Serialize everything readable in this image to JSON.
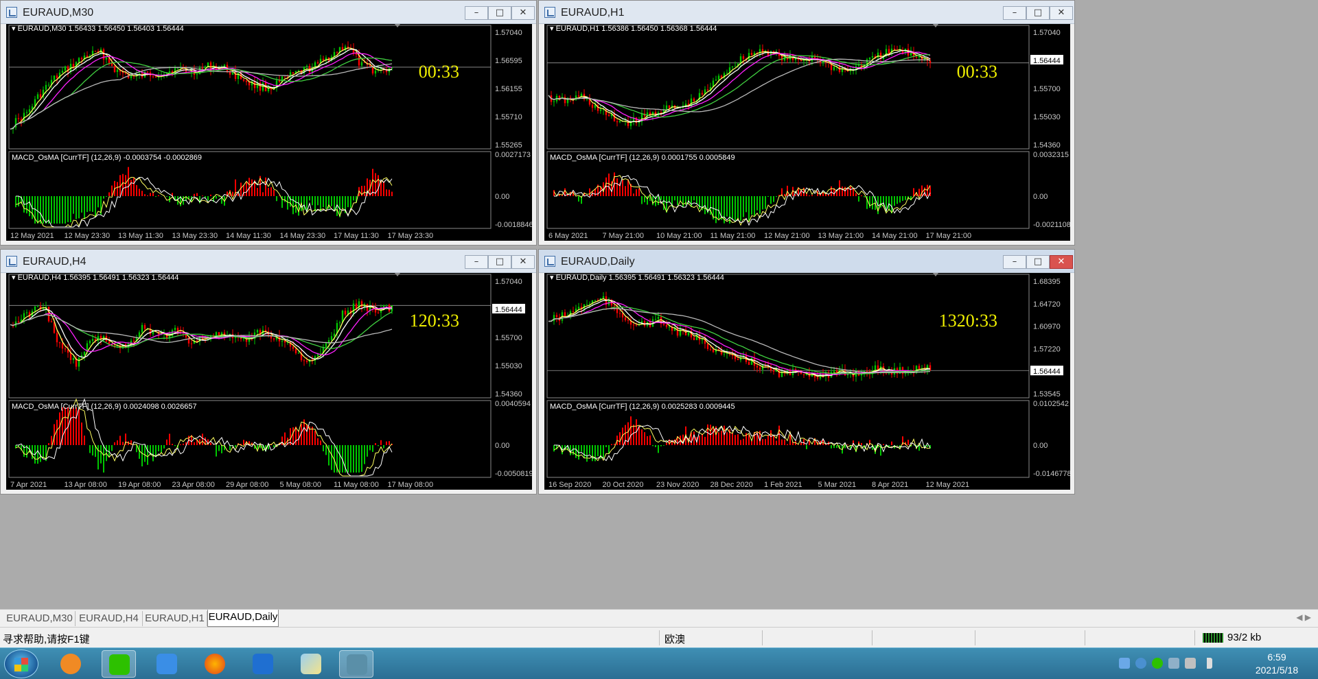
{
  "colors": {
    "bg": "#000000",
    "up": "#00c800",
    "down": "#ff0000",
    "ma_yellow": "#ffff60",
    "ma_white": "#ffffff",
    "ma_magenta": "#ff20ff",
    "ma_green": "#40d040",
    "ma_gray": "#b8b8b8",
    "timer": "#f0f000",
    "grid_text": "#c8c8c8"
  },
  "windows": [
    {
      "title": "EURAUD,M30",
      "info": "EURAUD,M30  1.56433 1.56450 1.56403 1.56444",
      "timer": "00:33",
      "price_levels": [
        "1.57040",
        "1.56595",
        "1.56155",
        "1.55710",
        "1.55265"
      ],
      "current_price": "1.56444",
      "macd_info": "MACD_OsMA [CurrTF] (12,26,9) -0.0003754 -0.0002869",
      "macd_levels": [
        "0.0027173",
        "0.00",
        "-0.0018846"
      ],
      "time_labels": [
        "12 May 2021",
        "12 May 23:30",
        "13 May 11:30",
        "13 May 23:30",
        "14 May 11:30",
        "14 May 23:30",
        "17 May 11:30",
        "17 May 23:30"
      ]
    },
    {
      "title": "EURAUD,H1",
      "info": "EURAUD,H1  1.56386 1.56450 1.56368 1.56444",
      "timer": "00:33",
      "price_levels": [
        "1.57040",
        "1.56444",
        "1.55700",
        "1.55030",
        "1.54360"
      ],
      "current_price": "1.56444",
      "macd_info": "MACD_OsMA [CurrTF] (12,26,9) 0.0001755 0.0005849",
      "macd_levels": [
        "0.0032315",
        "0.00",
        "-0.0021108"
      ],
      "time_labels": [
        "6 May 2021",
        "7 May 21:00",
        "10 May 21:00",
        "11 May 21:00",
        "12 May 21:00",
        "13 May 21:00",
        "14 May 21:00",
        "17 May 21:00"
      ]
    },
    {
      "title": "EURAUD,H4",
      "info": "EURAUD,H4  1.56395 1.56491 1.56323 1.56444",
      "timer": "120:33",
      "price_levels": [
        "1.57040",
        "1.56444",
        "1.55700",
        "1.55030",
        "1.54360"
      ],
      "current_price": "1.56444",
      "macd_info": "MACD_OsMA [CurrTF] (12,26,9) 0.0024098 0.0026657",
      "macd_levels": [
        "0.0040594",
        "0.00",
        "-0.0050819"
      ],
      "time_labels": [
        "7 Apr 2021",
        "13 Apr 08:00",
        "19 Apr 08:00",
        "23 Apr 08:00",
        "29 Apr 08:00",
        "5 May 08:00",
        "11 May 08:00",
        "17 May 08:00"
      ]
    },
    {
      "title": "EURAUD,Daily",
      "info": "EURAUD,Daily  1.56395 1.56491 1.56323 1.56444",
      "timer": "1320:33",
      "price_levels": [
        "1.68395",
        "1.64720",
        "1.60970",
        "1.57220",
        "1.56444",
        "1.53545"
      ],
      "current_price": "1.56444",
      "macd_info": "MACD_OsMA [CurrTF] (12,26,9) 0.0025283 0.0009445",
      "macd_levels": [
        "0.0102542",
        "0.00",
        "-0.0146778"
      ],
      "time_labels": [
        "16 Sep 2020",
        "20 Oct 2020",
        "23 Nov 2020",
        "28 Dec 2020",
        "1 Feb 2021",
        "5 Mar 2021",
        "8 Apr 2021",
        "12 May 2021"
      ]
    }
  ],
  "tabs": [
    "EURAUD,M30",
    "EURAUD,H4",
    "EURAUD,H1",
    "EURAUD,Daily"
  ],
  "active_tab": "EURAUD,Daily",
  "status": {
    "help": "寻求帮助,请按F1键",
    "symbol": "欧澳",
    "net": "93/2 kb"
  },
  "clock": {
    "time": "6:59",
    "date": "2021/5/18"
  },
  "taskbar_icons": [
    "start-orb-icon",
    "uc-browser-icon",
    "wechat-icon",
    "notes-pen-icon",
    "firefox-icon",
    "blue-m-app-icon",
    "paint-app-icon",
    "metatrader-icon"
  ]
}
